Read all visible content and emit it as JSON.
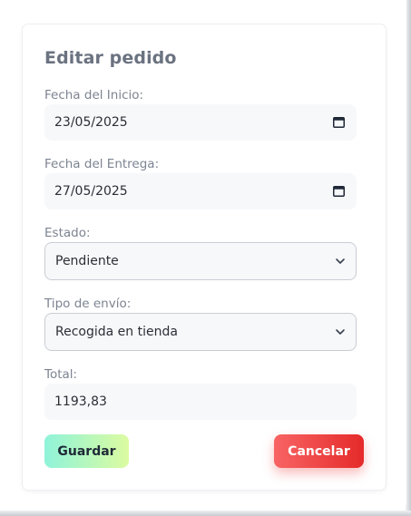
{
  "modal": {
    "title": "Editar pedido",
    "fields": {
      "start_date": {
        "label": "Fecha del Inicio:",
        "value": "23/05/2025"
      },
      "end_date": {
        "label": "Fecha del Entrega:",
        "value": "27/05/2025"
      },
      "status": {
        "label": "Estado:",
        "value": "Pendiente"
      },
      "shipping": {
        "label": "Tipo de envío:",
        "value": "Recogida en tienda"
      },
      "total": {
        "label": "Total:",
        "value": "1193,83"
      }
    },
    "buttons": {
      "save": "Guardar",
      "cancel": "Cancelar"
    }
  },
  "icons": {
    "date": "calendar-icon",
    "select": "chevron-down-icon"
  },
  "colors": {
    "save_gradient": [
      "#8ff3da",
      "#dcfba0"
    ],
    "cancel_gradient": [
      "#f86464",
      "#e52a2a"
    ],
    "background_accent": "#e8b23c"
  }
}
